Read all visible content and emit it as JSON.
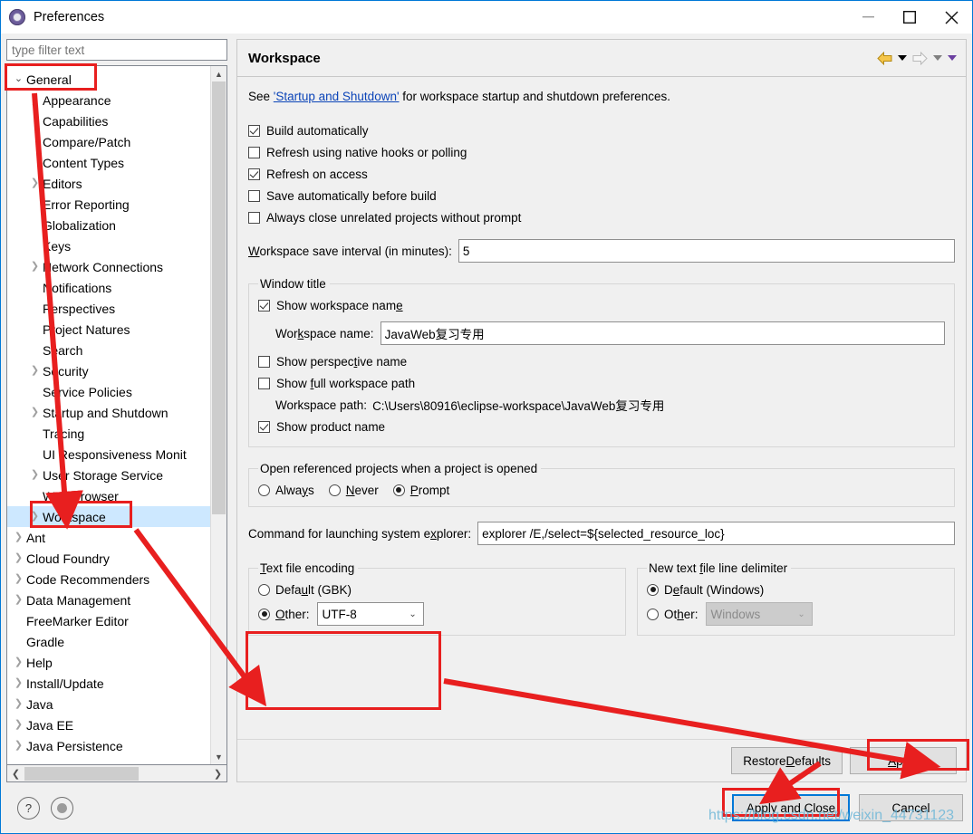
{
  "window": {
    "title": "Preferences",
    "icon": "preferences-gear-icon",
    "minimize_label": "Minimize",
    "maximize_label": "Maximize",
    "close_label": "Close",
    "accent_color": "#0078d7"
  },
  "sidebar": {
    "filter_placeholder": "type filter text",
    "filter_value": "",
    "items": [
      {
        "label": "General",
        "indent": 0,
        "twisty": "open",
        "selected": false
      },
      {
        "label": "Appearance",
        "indent": 1,
        "twisty": "closed",
        "selected": false
      },
      {
        "label": "Capabilities",
        "indent": 1,
        "twisty": "none",
        "selected": false
      },
      {
        "label": "Compare/Patch",
        "indent": 1,
        "twisty": "none",
        "selected": false
      },
      {
        "label": "Content Types",
        "indent": 1,
        "twisty": "none",
        "selected": false
      },
      {
        "label": "Editors",
        "indent": 1,
        "twisty": "closed",
        "selected": false
      },
      {
        "label": "Error Reporting",
        "indent": 1,
        "twisty": "none",
        "selected": false
      },
      {
        "label": "Globalization",
        "indent": 1,
        "twisty": "none",
        "selected": false
      },
      {
        "label": "Keys",
        "indent": 1,
        "twisty": "none",
        "selected": false
      },
      {
        "label": "Network Connections",
        "indent": 1,
        "twisty": "closed",
        "selected": false
      },
      {
        "label": "Notifications",
        "indent": 1,
        "twisty": "none",
        "selected": false
      },
      {
        "label": "Perspectives",
        "indent": 1,
        "twisty": "none",
        "selected": false
      },
      {
        "label": "Project Natures",
        "indent": 1,
        "twisty": "none",
        "selected": false
      },
      {
        "label": "Search",
        "indent": 1,
        "twisty": "none",
        "selected": false
      },
      {
        "label": "Security",
        "indent": 1,
        "twisty": "closed",
        "selected": false
      },
      {
        "label": "Service Policies",
        "indent": 1,
        "twisty": "none",
        "selected": false
      },
      {
        "label": "Startup and Shutdown",
        "indent": 1,
        "twisty": "closed",
        "selected": false
      },
      {
        "label": "Tracing",
        "indent": 1,
        "twisty": "none",
        "selected": false
      },
      {
        "label": "UI Responsiveness Monit",
        "indent": 1,
        "twisty": "none",
        "selected": false
      },
      {
        "label": "User Storage Service",
        "indent": 1,
        "twisty": "closed",
        "selected": false
      },
      {
        "label": "Web Browser",
        "indent": 1,
        "twisty": "none",
        "selected": false
      },
      {
        "label": "Workspace",
        "indent": 1,
        "twisty": "closed",
        "selected": true
      },
      {
        "label": "Ant",
        "indent": 0,
        "twisty": "closed",
        "selected": false
      },
      {
        "label": "Cloud Foundry",
        "indent": 0,
        "twisty": "closed",
        "selected": false
      },
      {
        "label": "Code Recommenders",
        "indent": 0,
        "twisty": "closed",
        "selected": false
      },
      {
        "label": "Data Management",
        "indent": 0,
        "twisty": "closed",
        "selected": false
      },
      {
        "label": "FreeMarker Editor",
        "indent": 0,
        "twisty": "none",
        "selected": false
      },
      {
        "label": "Gradle",
        "indent": 0,
        "twisty": "none",
        "selected": false
      },
      {
        "label": "Help",
        "indent": 0,
        "twisty": "closed",
        "selected": false
      },
      {
        "label": "Install/Update",
        "indent": 0,
        "twisty": "closed",
        "selected": false
      },
      {
        "label": "Java",
        "indent": 0,
        "twisty": "closed",
        "selected": false
      },
      {
        "label": "Java EE",
        "indent": 0,
        "twisty": "closed",
        "selected": false
      },
      {
        "label": "Java Persistence",
        "indent": 0,
        "twisty": "closed",
        "selected": false
      }
    ]
  },
  "page": {
    "title": "Workspace",
    "nav": {
      "back_label": "Back",
      "back_menu_label": "Back history",
      "forward_label": "Forward",
      "forward_menu_label": "Forward history",
      "view_menu_label": "View menu"
    },
    "see_prefix": "See ",
    "see_link": "'Startup and Shutdown'",
    "see_suffix": " for workspace startup and shutdown preferences.",
    "checkboxes": [
      {
        "label": "Build automatically",
        "mnemonic": "B",
        "checked": true
      },
      {
        "label": "Refresh using native hooks or polling",
        "mnemonic": "R",
        "checked": false
      },
      {
        "label": "Refresh on access",
        "mnemonic": "s",
        "checked": true
      },
      {
        "label": "Save automatically before build",
        "mnemonic": "m",
        "checked": false
      },
      {
        "label": "Always close unrelated projects without prompt",
        "mnemonic": "c",
        "checked": false
      }
    ],
    "save_interval": {
      "label": "Workspace save interval (in minutes):",
      "value": "5"
    },
    "window_title_group": {
      "legend": "Window title",
      "show_workspace_name": {
        "label": "Show workspace name",
        "checked": true
      },
      "workspace_name": {
        "label": "Workspace name:",
        "value": "JavaWeb复习专用"
      },
      "show_perspective_name": {
        "label": "Show perspective name",
        "checked": false
      },
      "show_full_workspace_path": {
        "label": "Show full workspace path",
        "checked": false
      },
      "workspace_path": {
        "label": "Workspace path:",
        "value": "C:\\Users\\80916\\eclipse-workspace\\JavaWeb复习专用"
      },
      "show_product_name": {
        "label": "Show product name",
        "checked": true
      }
    },
    "open_referenced_group": {
      "legend": "Open referenced projects when a project is opened",
      "options": [
        {
          "label": "Always",
          "selected": false
        },
        {
          "label": "Never",
          "selected": false
        },
        {
          "label": "Prompt",
          "selected": true
        }
      ]
    },
    "explorer_command": {
      "label": "Command for launching system explorer:",
      "value": "explorer /E,/select=${selected_resource_loc}"
    },
    "text_file_encoding": {
      "legend": "Text file encoding",
      "default_option": {
        "label": "Default (GBK)",
        "selected": false
      },
      "other_option": {
        "label": "Other:",
        "selected": true
      },
      "other_value": "UTF-8"
    },
    "line_delimiter": {
      "legend": "New text file line delimiter",
      "default_option": {
        "label": "Default (Windows)",
        "selected": true
      },
      "other_option": {
        "label": "Other:",
        "selected": false
      },
      "other_value": "Windows",
      "other_disabled": true
    },
    "buttons": {
      "restore_defaults": "Restore Defaults",
      "apply": "Apply"
    }
  },
  "footer": {
    "help_icon_label": "?",
    "secondary_icon_label": "pin-icon",
    "apply_and_close": "Apply and Close",
    "cancel": "Cancel"
  },
  "annotations": {
    "color": "#e81f1f",
    "watermark": "https://blog.csdn.net/weixin_44731123",
    "watermark_color": "#6fb7d8"
  }
}
